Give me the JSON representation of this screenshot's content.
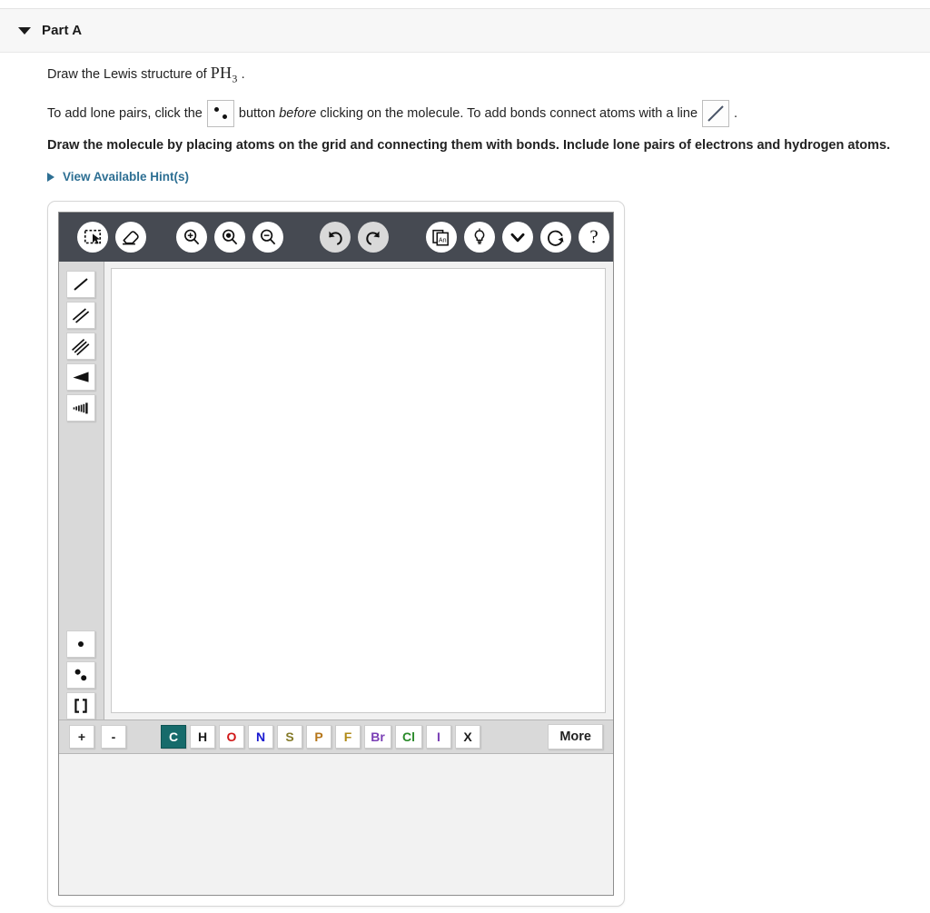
{
  "part": {
    "title": "Part A",
    "disclosure_icon": "caret-down-icon"
  },
  "prompt": {
    "line1_pre": "Draw the Lewis structure of ",
    "formula_element": "PH",
    "formula_subscript": "3",
    "line1_post": " .",
    "line2_a": "To add lone pairs, click the",
    "line2_b": "button",
    "line2_c": "before",
    "line2_d": "clicking on the molecule. To add bonds connect atoms with a line",
    "line2_e": ".",
    "line3": "Draw the molecule by placing atoms on the grid and connecting them with bonds. Include lone pairs of electrons and hydrogen atoms.",
    "lone_pair_button_icon": "lone-pair-icon",
    "bond_button_icon": "single-bond-icon"
  },
  "hints": {
    "label": "View Available Hint(s)",
    "caret_icon": "caret-right-icon",
    "color": "#2d6f93"
  },
  "editor": {
    "toolbar": {
      "background": "#464a52",
      "items": [
        {
          "name": "select-tool",
          "icon": "marquee-select-icon",
          "state": "enabled"
        },
        {
          "name": "erase-tool",
          "icon": "eraser-icon",
          "state": "enabled"
        },
        {
          "name": "zoom-in",
          "icon": "magnifier-plus-icon",
          "state": "enabled"
        },
        {
          "name": "zoom-reset",
          "icon": "magnifier-dot-icon",
          "state": "enabled"
        },
        {
          "name": "zoom-out",
          "icon": "magnifier-minus-icon",
          "state": "enabled"
        },
        {
          "name": "undo",
          "icon": "undo-arrow-icon",
          "state": "disabled"
        },
        {
          "name": "redo",
          "icon": "redo-arrow-icon",
          "state": "disabled"
        },
        {
          "name": "copy-template",
          "icon": "copy-page-an-icon",
          "state": "enabled"
        },
        {
          "name": "hint-bulb",
          "icon": "lightbulb-icon",
          "state": "enabled"
        },
        {
          "name": "more-options",
          "icon": "chevron-down-icon",
          "state": "enabled"
        },
        {
          "name": "reset-canvas",
          "icon": "refresh-circle-icon",
          "state": "enabled"
        },
        {
          "name": "help",
          "icon": "question-mark-icon",
          "state": "enabled"
        }
      ]
    },
    "rail": {
      "background": "#d9d9d9",
      "tools": [
        {
          "name": "single-bond",
          "icon": "single-bond-icon"
        },
        {
          "name": "double-bond",
          "icon": "double-bond-icon"
        },
        {
          "name": "triple-bond",
          "icon": "triple-bond-icon"
        },
        {
          "name": "wedge-bond",
          "icon": "wedge-bond-icon"
        },
        {
          "name": "hash-bond",
          "icon": "hash-bond-icon"
        },
        {
          "name": "radical-dot",
          "icon": "single-electron-icon"
        },
        {
          "name": "lone-pair",
          "icon": "lone-pair-icon"
        },
        {
          "name": "brackets",
          "icon": "brackets-icon"
        }
      ]
    },
    "palette": {
      "charge_buttons": [
        {
          "label": "+",
          "name": "increase-charge"
        },
        {
          "label": "-",
          "name": "decrease-charge"
        }
      ],
      "elements": [
        {
          "label": "C",
          "color": "#ffffff",
          "selected": true
        },
        {
          "label": "H",
          "color": "#1a1a1a",
          "selected": false
        },
        {
          "label": "O",
          "color": "#d01818",
          "selected": false
        },
        {
          "label": "N",
          "color": "#1818d0",
          "selected": false
        },
        {
          "label": "S",
          "color": "#857b2a",
          "selected": false
        },
        {
          "label": "P",
          "color": "#b5761a",
          "selected": false
        },
        {
          "label": "F",
          "color": "#b08a16",
          "selected": false
        },
        {
          "label": "Br",
          "color": "#7a3fb5",
          "selected": false
        },
        {
          "label": "Cl",
          "color": "#2a8a2a",
          "selected": false
        },
        {
          "label": "I",
          "color": "#7a3fb5",
          "selected": false
        },
        {
          "label": "X",
          "color": "#1a1a1a",
          "selected": false
        }
      ],
      "selected_color": "#176b6b",
      "more_label": "More"
    }
  }
}
